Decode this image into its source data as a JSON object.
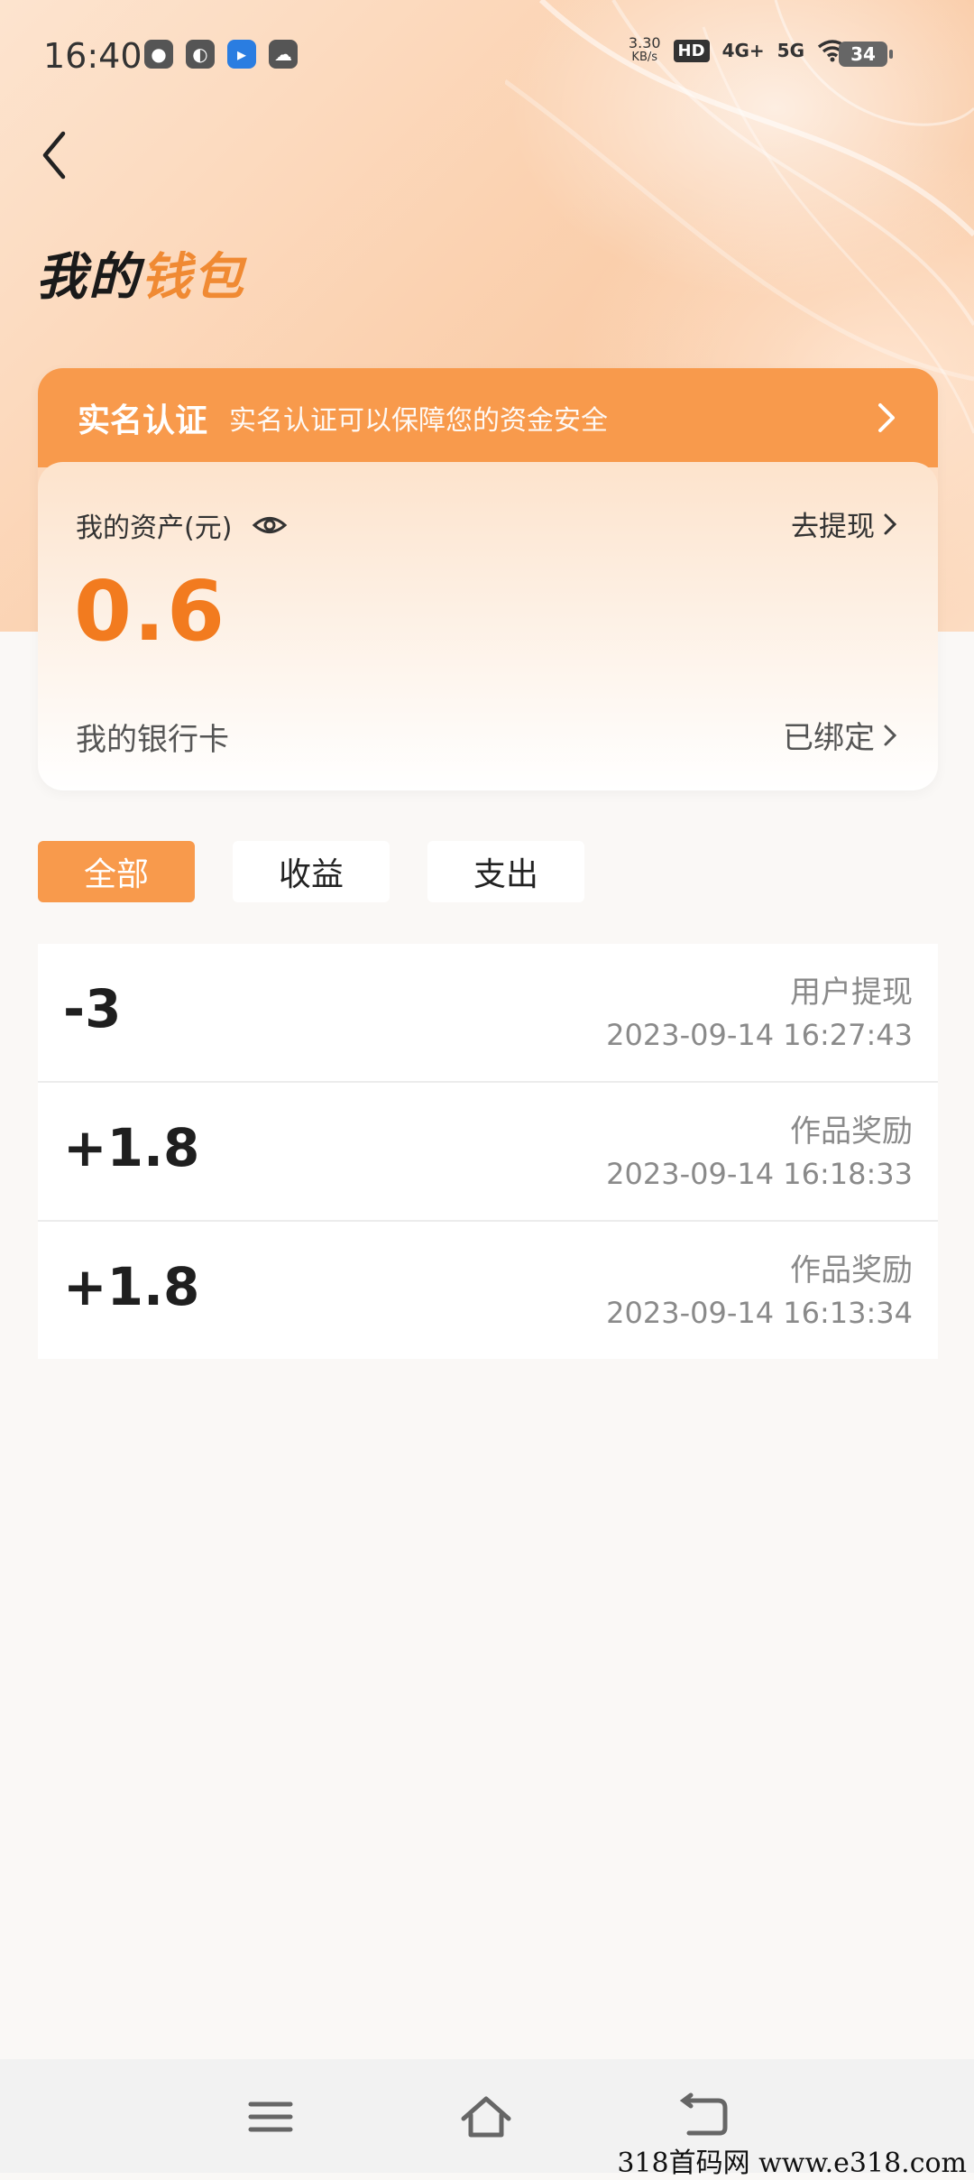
{
  "status_bar": {
    "time": "16:40",
    "net_speed": "3.30",
    "net_speed_unit": "KB/s",
    "hd_label": "HD",
    "net_4g": "4G+",
    "net_5g": "5G",
    "battery": "34"
  },
  "header": {
    "title_part1": "我的",
    "title_part2": "钱包"
  },
  "verify": {
    "title": "实名认证",
    "description": "实名认证可以保障您的资金安全"
  },
  "assets": {
    "label": "我的资产(元)",
    "withdraw_label": "去提现",
    "amount": "0.6",
    "bank_label": "我的银行卡",
    "bank_status": "已绑定"
  },
  "tabs": [
    {
      "label": "全部",
      "active": true
    },
    {
      "label": "收益",
      "active": false
    },
    {
      "label": "支出",
      "active": false
    }
  ],
  "transactions": [
    {
      "amount": "-3",
      "type": "用户提现",
      "time": "2023-09-14 16:27:43"
    },
    {
      "amount": "+1.8",
      "type": "作品奖励",
      "time": "2023-09-14 16:18:33"
    },
    {
      "amount": "+1.8",
      "type": "作品奖励",
      "time": "2023-09-14 16:13:34"
    }
  ],
  "watermark": "318首码网  www.e318.com",
  "colors": {
    "accent": "#f89a4c",
    "amount": "#f27b1f"
  }
}
